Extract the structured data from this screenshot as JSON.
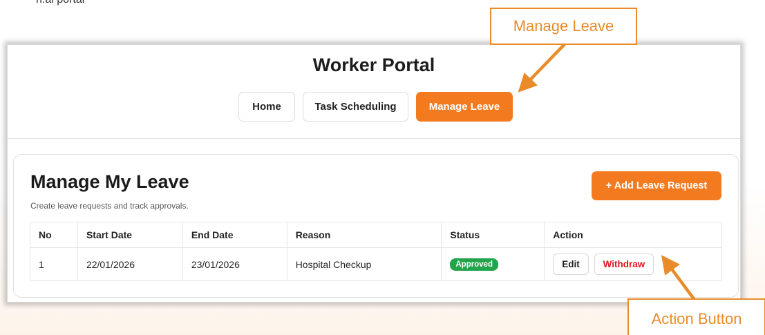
{
  "page_top_text": "n.ai portal",
  "app": {
    "title": "Worker Portal",
    "nav": [
      {
        "label": "Home",
        "active": false
      },
      {
        "label": "Task Scheduling",
        "active": false
      },
      {
        "label": "Manage Leave",
        "active": true
      }
    ]
  },
  "leave": {
    "title": "Manage My Leave",
    "subtitle": "Create leave requests and track approvals.",
    "add_button": "+ Add Leave Request",
    "columns": [
      "No",
      "Start Date",
      "End Date",
      "Reason",
      "Status",
      "Action"
    ],
    "rows": [
      {
        "no": "1",
        "start_date": "22/01/2026",
        "end_date": "23/01/2026",
        "reason": "Hospital Checkup",
        "status": "Approved",
        "edit_label": "Edit",
        "withdraw_label": "Withdraw"
      }
    ]
  },
  "annotations": {
    "manage_leave_callout": "Manage Leave",
    "action_button_callout": "Action Button",
    "callout_color": "#e98b2a"
  },
  "colors": {
    "accent": "#f47a20",
    "approved": "#22a44a",
    "withdraw": "#e0161e"
  }
}
